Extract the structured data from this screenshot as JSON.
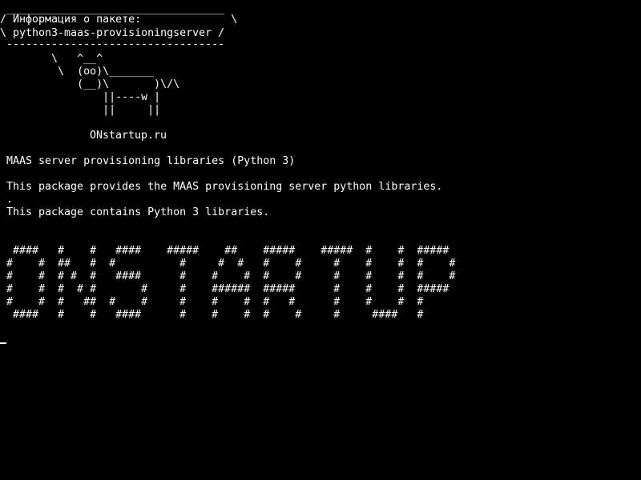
{
  "theme": {
    "background": "#000000",
    "foreground": "#ffffff"
  },
  "cowsay": {
    "top_rule": " __________________________________",
    "header_1": "/ Информация о пакете:              \\",
    "header_2": "\\ python3-maas-provisioningserver /",
    "bottom_rule": " ----------------------------------",
    "cow": [
      "        \\   ^__^",
      "         \\  (oo)\\_______",
      "            (__)\\       )\\/\\",
      "                ||----w |",
      "                ||     ||"
    ]
  },
  "site": "ONstartup.ru",
  "description": {
    "summary": "MAAS server provisioning libraries (Python 3)",
    "details": [
      "This package provides the MAAS provisioning server python libraries.",
      ".",
      "This package contains Python 3 libraries."
    ]
  },
  "banner": [
    " ####   #    #   ####    #####    ##    #####    #####  #    #  #####",
    "#    #  ##   #  #          #     #  #   #    #     #    #    #  #    #",
    "#    #  # #  #   ####      #    #    #  #    #     #    #    #  #    #",
    "#    #  #  # #       #     #    ######  #####      #    #    #  #####",
    "#    #  #   ##  #    #     #    #    #  #   #      #    #    #  #",
    " ####   #    #   ####      #    #    #  #    #     #     ####   #"
  ]
}
